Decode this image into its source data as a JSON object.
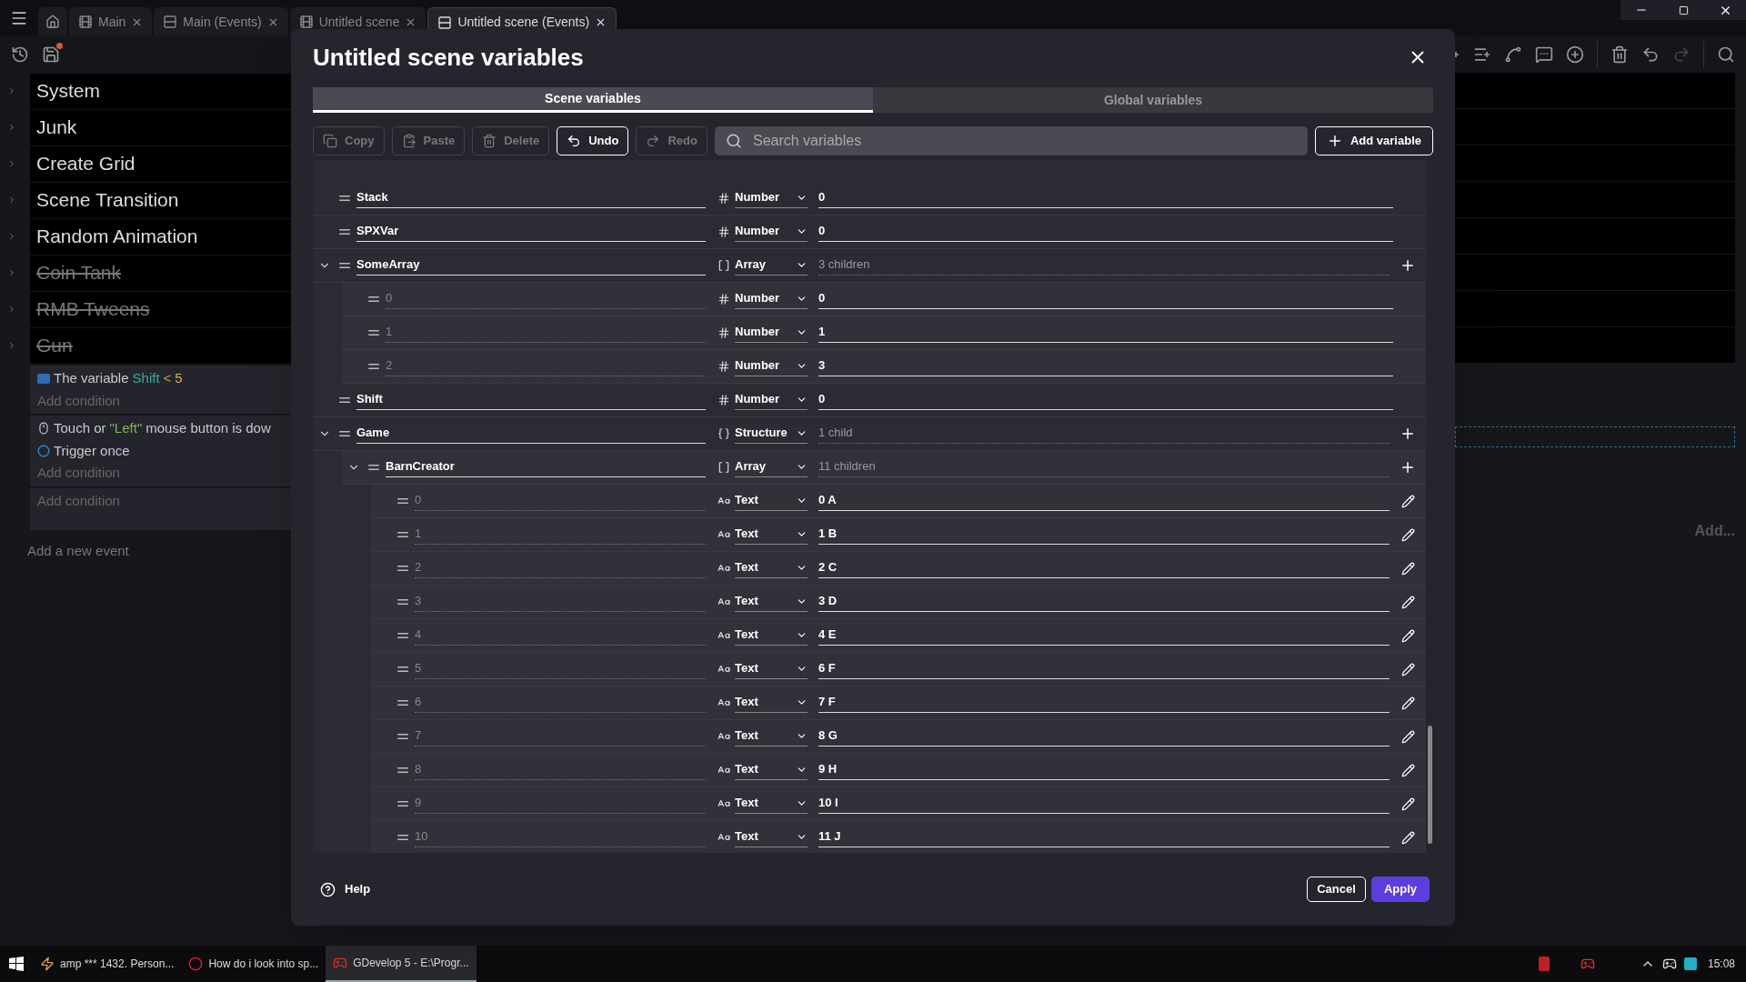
{
  "doc_tabs": [
    {
      "label": "Main",
      "kind": "scene",
      "selected": false
    },
    {
      "label": "Main (Events)",
      "kind": "events",
      "selected": false
    },
    {
      "label": "Untitled scene",
      "kind": "scene",
      "selected": false
    },
    {
      "label": "Untitled scene (Events)",
      "kind": "events",
      "selected": true
    }
  ],
  "event_groups": [
    {
      "name": "System",
      "disabled": false
    },
    {
      "name": "Junk",
      "disabled": false
    },
    {
      "name": "Create Grid",
      "disabled": false
    },
    {
      "name": "Scene Transition",
      "disabled": false
    },
    {
      "name": "Random Animation",
      "disabled": false
    },
    {
      "name": "Coin Tank",
      "disabled": true
    },
    {
      "name": "RMB Tweens",
      "disabled": true
    },
    {
      "name": "Gun",
      "disabled": true
    }
  ],
  "events": [
    {
      "conditions": [
        {
          "kind": "variable",
          "parts": [
            {
              "text": "The variable",
              "kind": "plain"
            },
            {
              "text": "Shift",
              "kind": "variable"
            },
            {
              "text": "<",
              "kind": "operator"
            },
            {
              "text": "5",
              "kind": "number"
            }
          ]
        }
      ],
      "add_condition": "Add condition"
    },
    {
      "conditions": [
        {
          "kind": "mouse",
          "parts": [
            {
              "text": "Touch or",
              "kind": "plain"
            },
            {
              "text": "\"Left\"",
              "kind": "string"
            },
            {
              "text": "mouse button is dow",
              "kind": "plain"
            }
          ]
        },
        {
          "kind": "trigger",
          "parts": [
            {
              "text": "Trigger once",
              "kind": "plain"
            }
          ]
        }
      ],
      "add_condition": "Add condition"
    },
    {
      "add_condition": "Add condition"
    }
  ],
  "add_event": "Add a new event",
  "add_right": "Add...",
  "dialog": {
    "title": "Untitled scene variables",
    "tabs": [
      {
        "label": "Scene variables",
        "selected": true
      },
      {
        "label": "Global variables",
        "selected": false
      }
    ],
    "toolbar": [
      {
        "label": "Copy",
        "kind": "copy",
        "disabled": true
      },
      {
        "label": "Paste",
        "kind": "paste",
        "disabled": true
      },
      {
        "label": "Delete",
        "kind": "delete",
        "disabled": true
      },
      {
        "label": "Undo",
        "kind": "undo",
        "disabled": false
      },
      {
        "label": "Redo",
        "kind": "redo",
        "disabled": true
      }
    ],
    "search": {
      "placeholder": "Search variables"
    },
    "add_button": "Add variable",
    "variables": [
      {
        "name": "Stack",
        "kind": "named",
        "type": "Number",
        "value": "0"
      },
      {
        "name": "SPXVar",
        "kind": "named",
        "type": "Number",
        "value": "0"
      },
      {
        "name": "SomeArray",
        "kind": "named",
        "type": "Array",
        "summary": "3 children",
        "expanded": true,
        "children": [
          {
            "name": "0",
            "kind": "index",
            "type": "Number",
            "value": "0"
          },
          {
            "name": "1",
            "kind": "index",
            "type": "Number",
            "value": "1"
          },
          {
            "name": "2",
            "kind": "index",
            "type": "Number",
            "value": "3"
          }
        ]
      },
      {
        "name": "Shift",
        "kind": "named",
        "type": "Number",
        "value": "0"
      },
      {
        "name": "Game",
        "kind": "named",
        "type": "Structure",
        "summary": "1 child",
        "expanded": true,
        "children": [
          {
            "name": "BarnCreator",
            "kind": "named",
            "type": "Array",
            "summary": "11 children",
            "expanded": true,
            "children": [
              {
                "name": "0",
                "kind": "index",
                "type": "Text",
                "value": "0 A"
              },
              {
                "name": "1",
                "kind": "index",
                "type": "Text",
                "value": "1 B"
              },
              {
                "name": "2",
                "kind": "index",
                "type": "Text",
                "value": "2 C"
              },
              {
                "name": "3",
                "kind": "index",
                "type": "Text",
                "value": "3 D"
              },
              {
                "name": "4",
                "kind": "index",
                "type": "Text",
                "value": "4 E"
              },
              {
                "name": "5",
                "kind": "index",
                "type": "Text",
                "value": "6 F"
              },
              {
                "name": "6",
                "kind": "index",
                "type": "Text",
                "value": "7 F"
              },
              {
                "name": "7",
                "kind": "index",
                "type": "Text",
                "value": "8 G"
              },
              {
                "name": "8",
                "kind": "index",
                "type": "Text",
                "value": "9 H"
              },
              {
                "name": "9",
                "kind": "index",
                "type": "Text",
                "value": "10 I"
              },
              {
                "name": "10",
                "kind": "index",
                "type": "Text",
                "value": "11 J"
              }
            ]
          }
        ]
      }
    ],
    "help": "Help",
    "cancel": "Cancel",
    "apply": "Apply"
  },
  "taskbar": {
    "items": [
      {
        "label": "amp *** 1432. Person...",
        "kind": "bolt",
        "selected": false
      },
      {
        "label": "How do i look into sp...",
        "kind": "browser",
        "selected": false
      },
      {
        "label": "GDevelop 5 - E:\\Progr...",
        "kind": "app",
        "selected": true
      }
    ],
    "time": "15:08"
  }
}
